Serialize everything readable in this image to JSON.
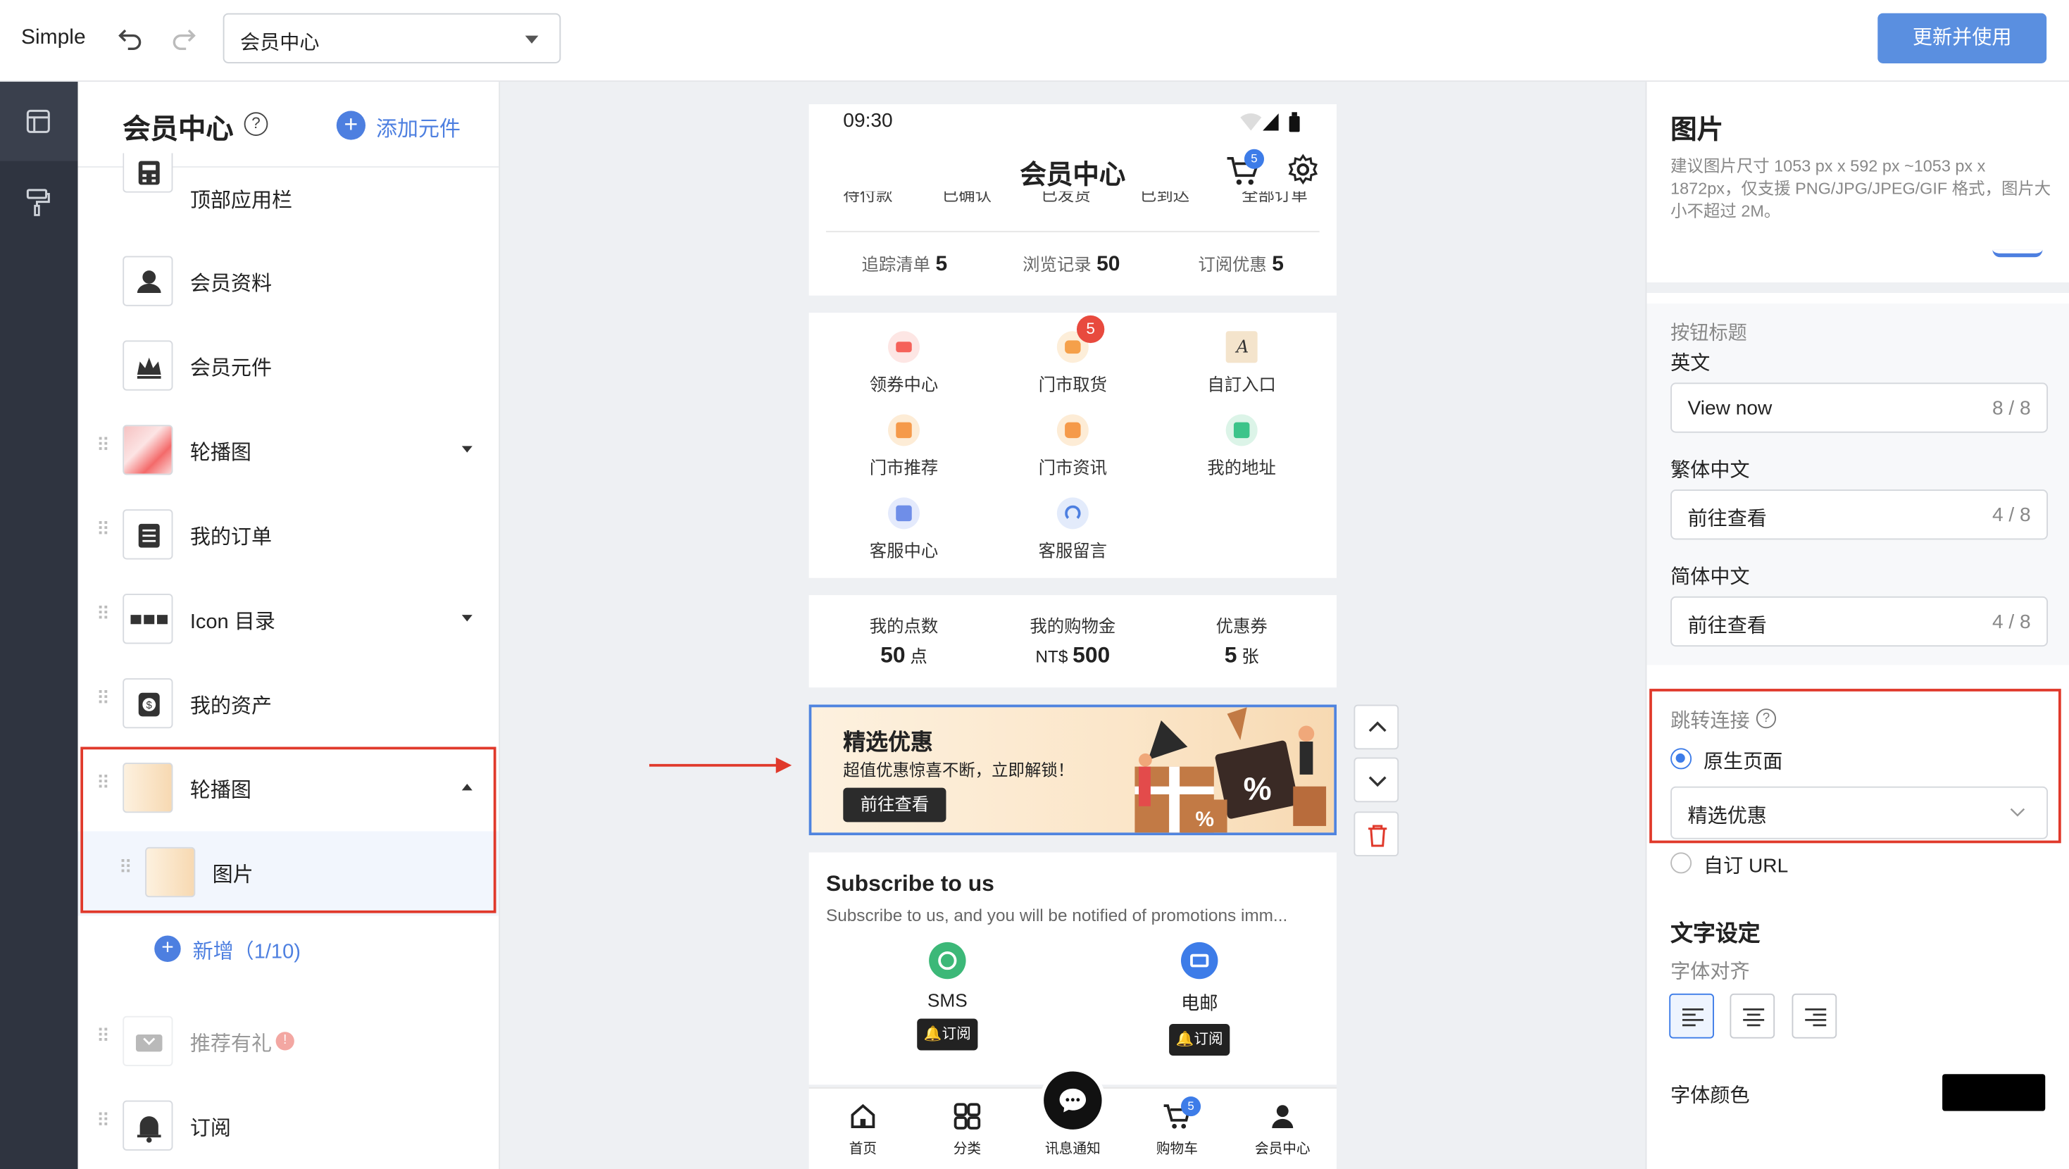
{
  "topbar": {
    "brand": "Simple",
    "page_select": "会员中心",
    "publish": "更新并使用"
  },
  "panel": {
    "title": "会员中心",
    "help": "?",
    "add_label": "添加元件",
    "items": [
      {
        "label": "顶部应用栏"
      },
      {
        "label": "会员资料"
      },
      {
        "label": "会员元件"
      },
      {
        "label": "轮播图"
      },
      {
        "label": "我的订单"
      },
      {
        "label": "Icon 目录"
      },
      {
        "label": "我的资产"
      },
      {
        "label": "轮播图"
      },
      {
        "label": "图片"
      },
      {
        "label": "新增（1/10)"
      },
      {
        "label": "推荐有礼"
      },
      {
        "label": "订阅"
      }
    ]
  },
  "phone": {
    "time": "09:30",
    "header_title": "会员中心",
    "cart_badge": "5",
    "order_tabs": [
      "待付款",
      "已确认",
      "已发货",
      "已到达",
      "全部订单"
    ],
    "stats": [
      {
        "label": "追踪清单",
        "value": "5"
      },
      {
        "label": "浏览记录",
        "value": "50"
      },
      {
        "label": "订阅优惠",
        "value": "5"
      }
    ],
    "icons": [
      {
        "label": "领券中心",
        "color": "#f5625a"
      },
      {
        "label": "门市取货",
        "color": "#f5a04a",
        "badge": "5"
      },
      {
        "label": "自訂入口",
        "color": "#c9a06a"
      },
      {
        "label": "门市推荐",
        "color": "#f59a4a"
      },
      {
        "label": "门市资讯",
        "color": "#f59a4a"
      },
      {
        "label": "我的地址",
        "color": "#3cc48a"
      },
      {
        "label": "客服中心",
        "color": "#6f8ee8"
      },
      {
        "label": "客服留言",
        "color": "#4d7fe0"
      }
    ],
    "assets": [
      {
        "label": "我的点数",
        "value": "50",
        "unit": " 点",
        "prefix": ""
      },
      {
        "label": "我的购物金",
        "value": "500",
        "unit": "",
        "prefix": "NT$ "
      },
      {
        "label": "优惠券",
        "value": "5",
        "unit": " 张",
        "prefix": ""
      }
    ],
    "banner": {
      "title": "精选优惠",
      "subtitle": "超值优惠惊喜不断，立即解锁！",
      "button": "前往查看"
    },
    "subscribe": {
      "title": "Subscribe to us",
      "desc": "Subscribe to us, and you will be notified of promotions imm...",
      "channels": [
        {
          "name": "SMS",
          "button": "订阅",
          "color": "#3cb878"
        },
        {
          "name": "电邮",
          "button": "订阅",
          "color": "#3d7ce8"
        }
      ]
    },
    "tabs": [
      {
        "label": "首页"
      },
      {
        "label": "分类"
      },
      {
        "label": "讯息通知"
      },
      {
        "label": "购物车",
        "badge": "5"
      },
      {
        "label": "会员中心"
      }
    ]
  },
  "right": {
    "title": "图片",
    "desc": "建议图片尺寸 1053 px x 592  px ~1053 px x 1872px，仅支援 PNG/JPG/JPEG/GIF 格式，图片大小不超过 2M。",
    "btn_title_label": "按钮标题",
    "fields": [
      {
        "label": "英文",
        "value": "View now",
        "count": "8 / 8"
      },
      {
        "label": "繁体中文",
        "value": "前往查看",
        "count": "4 / 8"
      },
      {
        "label": "简体中文",
        "value": "前往查看",
        "count": "4 / 8"
      }
    ],
    "link_label": "跳转连接",
    "link_native": "原生页面",
    "link_page": "精选优惠",
    "link_custom": "自订 URL",
    "text_settings": "文字设定",
    "align_label": "字体对齐",
    "color_label": "字体颜色",
    "font_color": "#000000"
  }
}
